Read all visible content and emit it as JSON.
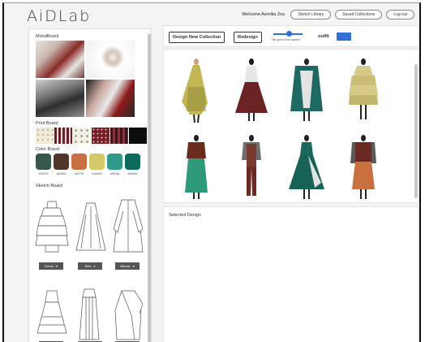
{
  "app": {
    "logo": "AiDLab"
  },
  "topbar": {
    "welcome": "Welcome Aemilia Zou",
    "sketch_library": "Sketch Library",
    "saved_collections": "Saved Collections",
    "logout": "Log out"
  },
  "left_panel": {
    "moodboard_title": "MoodBoard",
    "print_title": "Print Board",
    "color_title": "Color Board",
    "sketch_title": "Sketch Board",
    "colors": [
      {
        "hex": "#36574c",
        "label": "#36574c"
      },
      {
        "hex": "#4f352a",
        "label": "#4f352a"
      },
      {
        "hex": "#c8703f",
        "label": "#c8703f"
      },
      {
        "hex": "#d3c96b",
        "label": "#cac96b"
      },
      {
        "hex": "#2f9a8a",
        "label": "#2f9c8a"
      },
      {
        "hex": "#0b6a5c",
        "label": "#0b6a5c"
      }
    ],
    "sketch_dropdowns": [
      {
        "label": "Dress"
      },
      {
        "label": "Skirt"
      },
      {
        "label": "Blouse"
      }
    ]
  },
  "controls": {
    "design_new": "Design New Collection",
    "redesign": "Redesign",
    "slider_caption": "Title given from system",
    "slider_value": 0.55,
    "outfit_label": "outfit",
    "toggle_color": "#2f6fd6"
  },
  "selected": {
    "title": "Selected Design"
  }
}
